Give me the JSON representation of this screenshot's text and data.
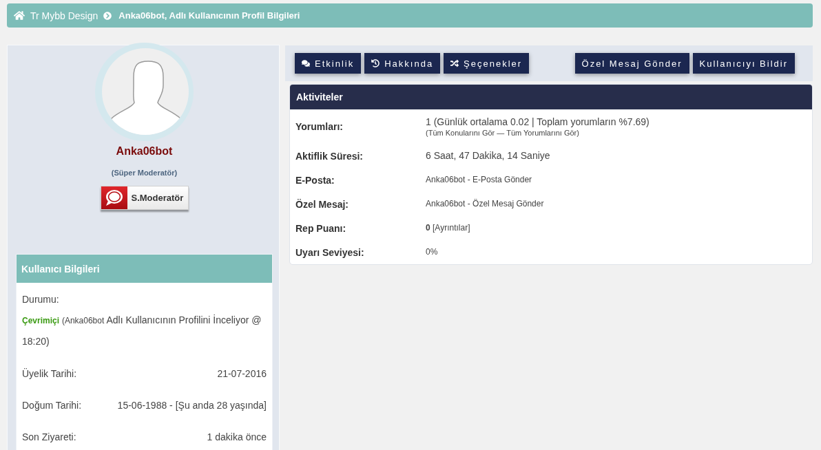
{
  "breadcrumb": {
    "links": [
      {
        "label": "Tr Mybb Design",
        "kind": "home"
      }
    ],
    "current": "Anka06bot, Adlı Kullanıcının Profil Bilgileri"
  },
  "profile": {
    "username": "Anka06bot",
    "user_title": "(Süper Moderatör)",
    "rank_badge": "S.Moderatör"
  },
  "user_info": {
    "title": "Kullanıcı Bilgileri",
    "status": {
      "label": "Durumu:",
      "online": true,
      "state": "Çevrimiçi",
      "activity_user": "(Anka06bot",
      "activity": "Adlı Kullanıcının Profilini İnceliyor @ 18:20)"
    },
    "rows": [
      {
        "label": "Üyelik Tarihi:",
        "value": "21-07-2016"
      },
      {
        "label": "Doğum Tarihi:",
        "value": "15-06-1988 - [Şu anda 28 yaşında]"
      },
      {
        "label": "Son Ziyareti:",
        "value": "1 dakika önce"
      }
    ]
  },
  "toolbar": {
    "nav_buttons": [
      {
        "label": "Etkinlik",
        "kind": "activity"
      },
      {
        "label": "Hakkında",
        "kind": "about"
      },
      {
        "label": "Şeçenekler",
        "kind": "options"
      }
    ],
    "action_buttons": [
      "Özel Mesaj Gönder",
      "Kullanıcıyı Bildir"
    ]
  },
  "activity": {
    "title": "Aktiviteler",
    "rows": [
      {
        "label": "Yorumları:",
        "kind": "stat",
        "value": "1 (Günlük ortalama 0.02 | Toplam yorumların %7.69)",
        "note": "(Tüm Konularını Gör — Tüm Yorumlarını Gör)"
      },
      {
        "label": "Aktiflik Süresi:",
        "kind": "stat",
        "value": "6 Saat, 47 Dakika, 14 Saniye"
      },
      {
        "label": "E-Posta:",
        "kind": "detail",
        "value": "Anka06bot - E-Posta Gönder"
      },
      {
        "label": "Özel Mesaj:",
        "kind": "detail",
        "value": "Anka06bot - Özel Mesaj Gönder"
      },
      {
        "label": "Rep Puanı:",
        "kind": "detail",
        "value": "**0** [Ayrıntılar]"
      },
      {
        "label": "Uyarı Seviyesi:",
        "kind": "detail",
        "value": "0%"
      }
    ]
  }
}
